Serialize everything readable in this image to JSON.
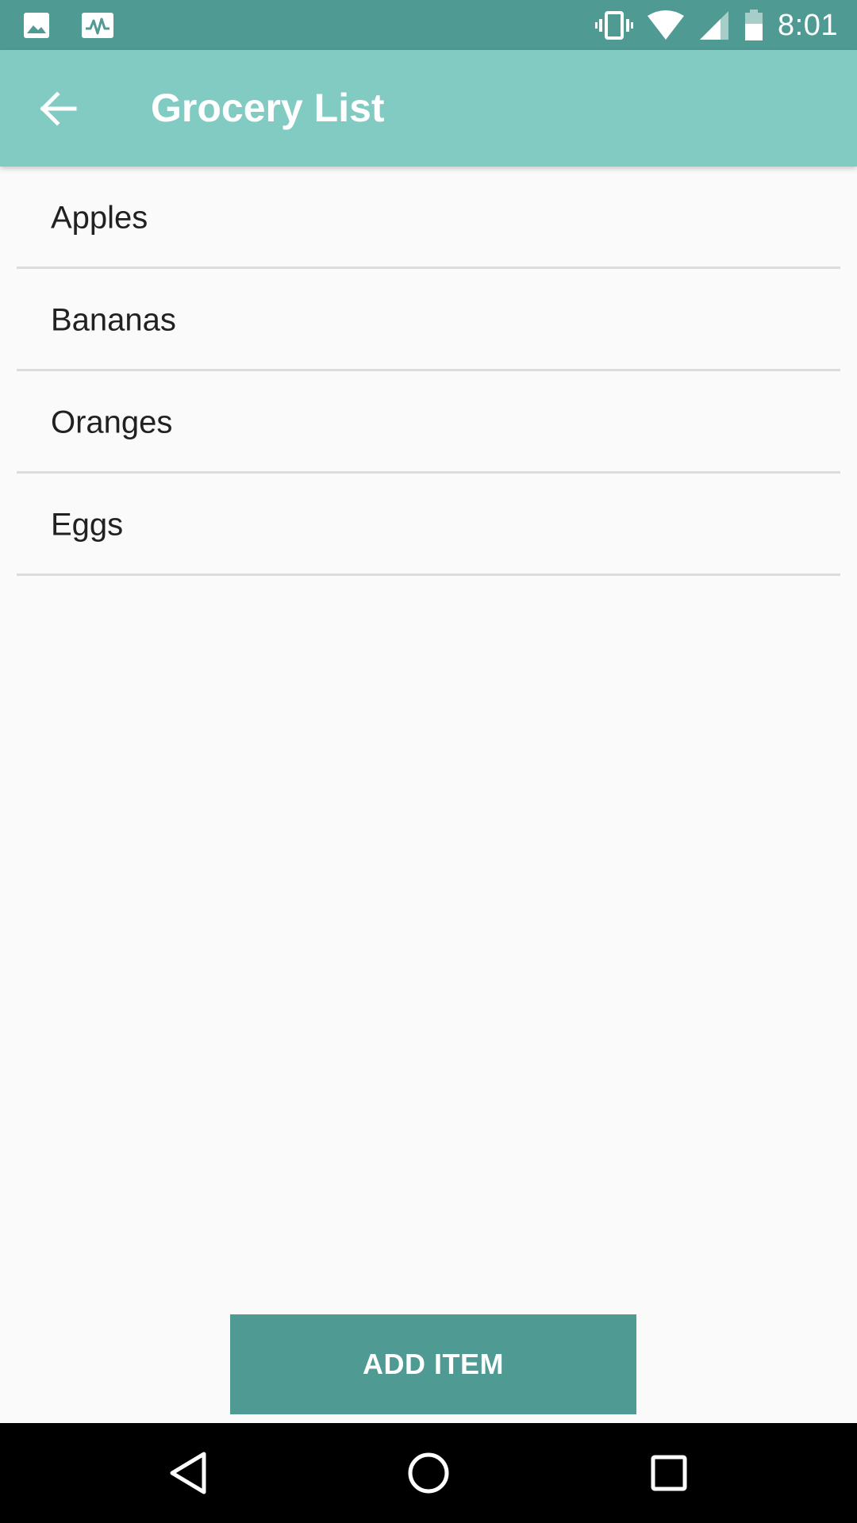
{
  "status_bar": {
    "time": "8:01",
    "left_icons": [
      "image-icon",
      "activity-icon"
    ],
    "right_icons": [
      "vibrate-icon",
      "wifi-icon",
      "signal-icon",
      "battery-icon"
    ]
  },
  "app_bar": {
    "title": "Grocery List",
    "back_icon": "arrow-back-icon"
  },
  "list": {
    "items": [
      {
        "label": "Apples"
      },
      {
        "label": "Bananas"
      },
      {
        "label": "Oranges"
      },
      {
        "label": "Eggs"
      }
    ]
  },
  "actions": {
    "add_item_label": "ADD ITEM"
  },
  "nav_bar": {
    "icons": [
      "nav-back-icon",
      "nav-home-icon",
      "nav-recents-icon"
    ]
  },
  "colors": {
    "status_bar": "#4f9a93",
    "app_bar": "#81cbc3",
    "button": "#4f9a93",
    "background": "#fafafa",
    "text": "#212121",
    "divider": "#dcdcdc"
  }
}
